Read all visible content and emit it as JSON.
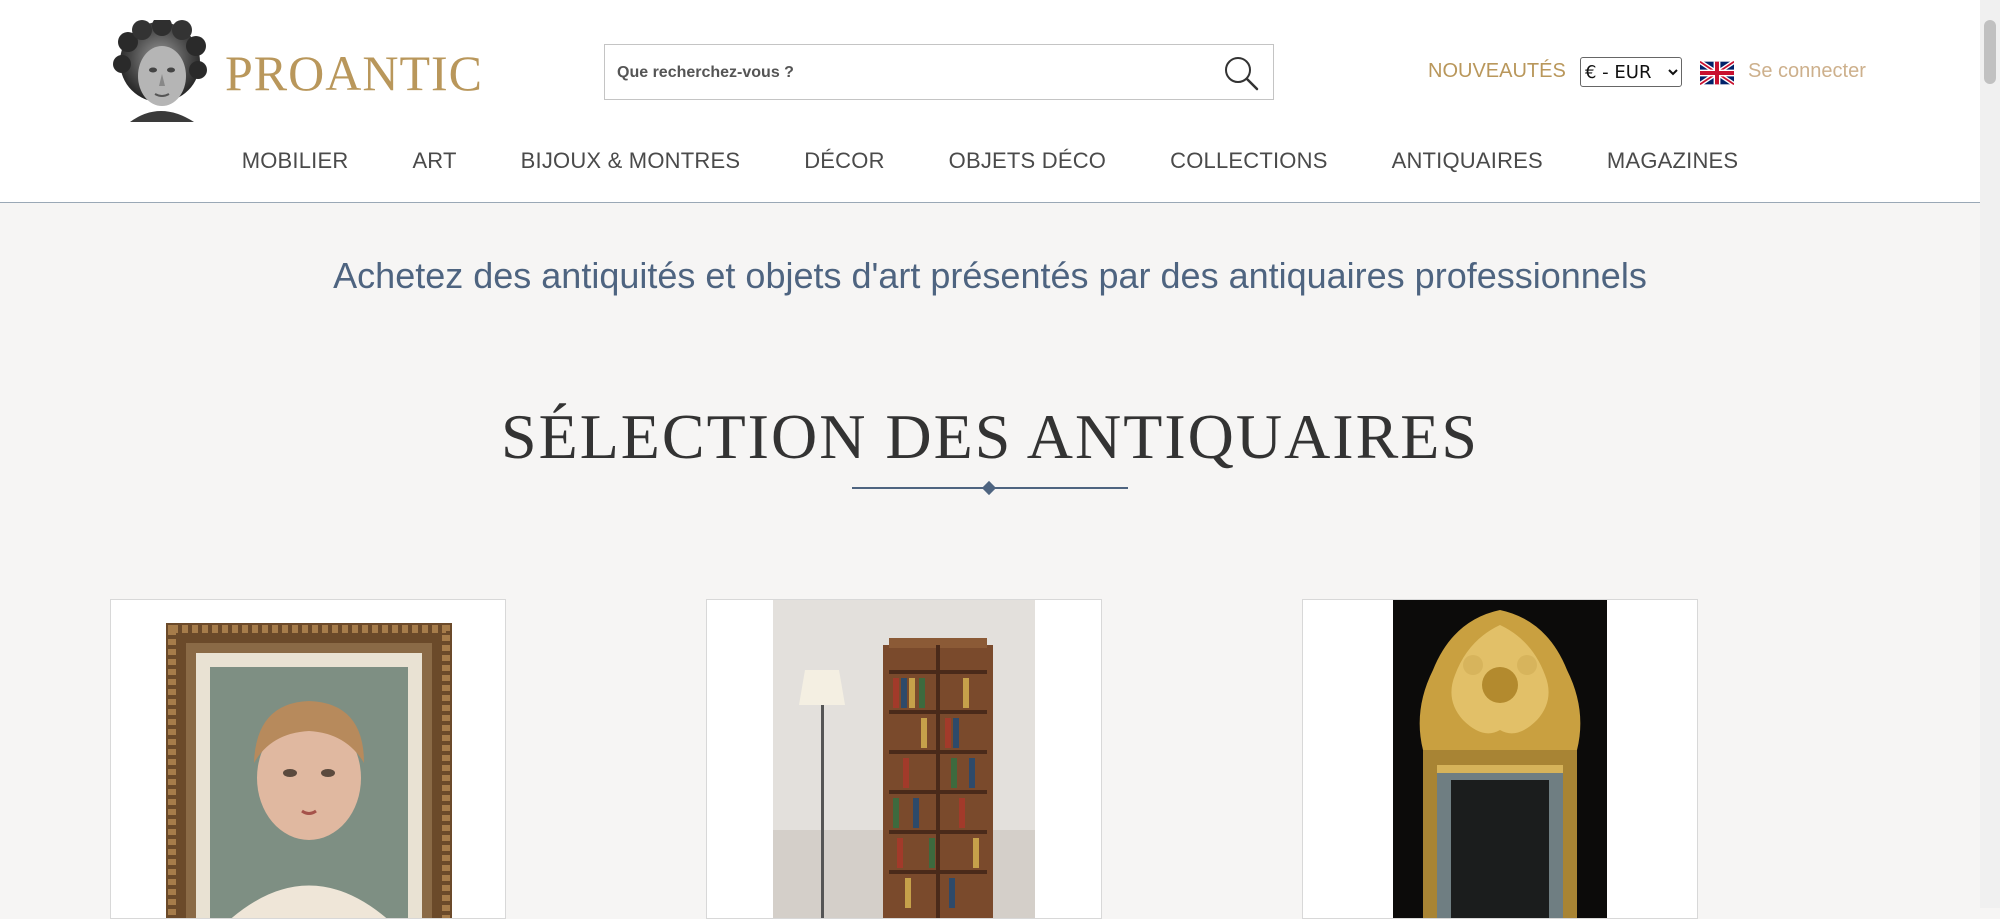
{
  "brand": {
    "name": "PROANTIC"
  },
  "search": {
    "placeholder": "Que recherchez-vous ?"
  },
  "header": {
    "new_label": "NOUVEAUTÉS",
    "currency": {
      "selected": "€ - EUR",
      "options": [
        "€ - EUR"
      ]
    },
    "language_flag": "uk-flag-icon",
    "login_label": "Se connecter"
  },
  "nav": {
    "items": [
      {
        "label": "MOBILIER"
      },
      {
        "label": "ART"
      },
      {
        "label": "BIJOUX & MONTRES"
      },
      {
        "label": "DÉCOR"
      },
      {
        "label": "OBJETS DÉCO"
      },
      {
        "label": "COLLECTIONS"
      },
      {
        "label": "ANTIQUAIRES"
      },
      {
        "label": "MAGAZINES"
      }
    ]
  },
  "intro": {
    "text": "Achetez des antiquités et objets d'art présentés par des antiquaires professionnels"
  },
  "selection": {
    "title": "SÉLECTION DES ANTIQUAIRES"
  },
  "colors": {
    "gold": "#b9975b",
    "blue": "#4e6480",
    "background": "#f6f5f4"
  }
}
